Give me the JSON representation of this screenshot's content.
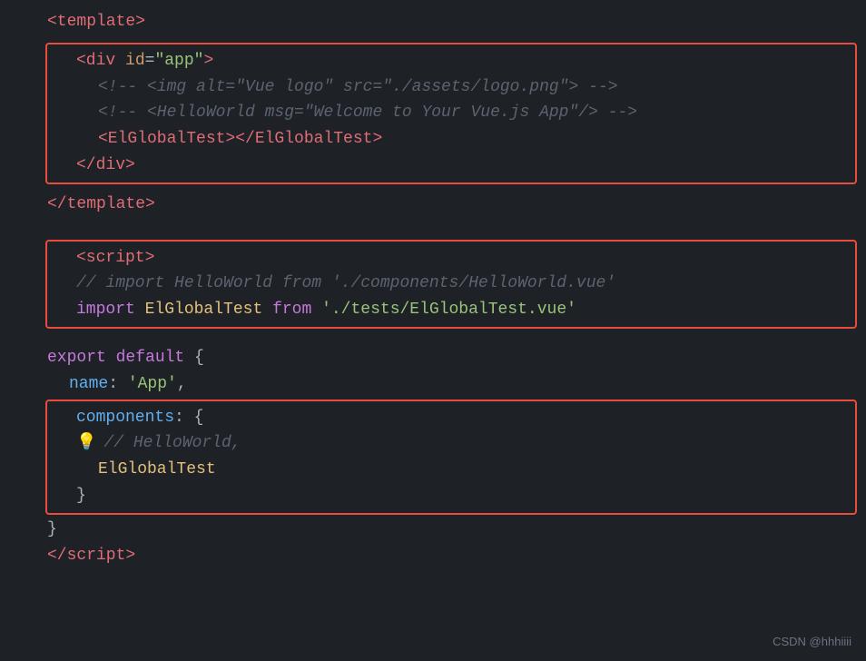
{
  "code": {
    "template_open": "<template>",
    "template_close": "</template>",
    "script_open": "<script>",
    "script_close": "</script>",
    "div_open": "<div id=\"app\">",
    "comment1": "<!-- <img alt=\"Vue logo\" src=\"./assets/logo.png\"> -->",
    "comment2": "<!-- <HelloWorld msg=\"Welcome to Your Vue.js App\"/> -->",
    "el_global_tag": "<ElGlobalTest></ElGlobalTest>",
    "div_close": "</div>",
    "comment_import": "// import HelloWorld from './components/HelloWorld.vue'",
    "import_line": "import ElGlobalTest from './tests/ElGlobalTest.vue'",
    "export_default": "export default {",
    "name_line": "name: 'App',",
    "components_line": "components: {",
    "comment_hello": "// HelloWorld,",
    "el_global_comp": "ElGlobalTest",
    "close_brace": "}",
    "close_brace2": "}",
    "watermark": "CSDN @hhhiiii"
  }
}
